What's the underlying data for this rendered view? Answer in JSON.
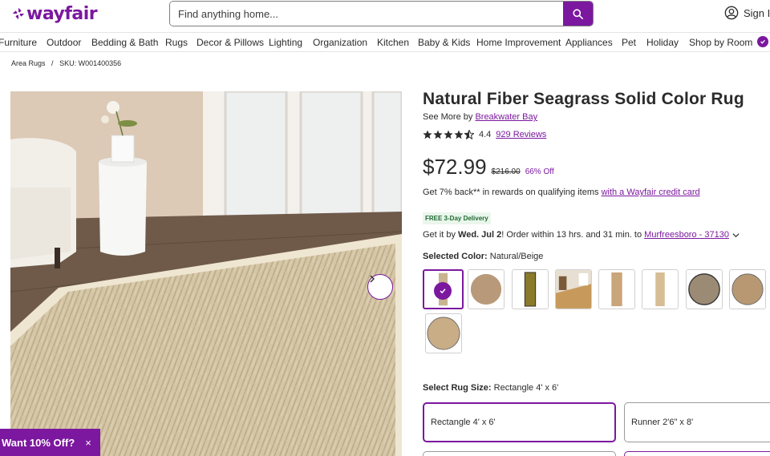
{
  "brand": {
    "name": "wayfair",
    "color": "#7b189f"
  },
  "search": {
    "placeholder": "Find anything home...",
    "icon": "search-icon"
  },
  "account": {
    "label": "Sign In",
    "icon": "user-circle-icon"
  },
  "nav": {
    "items": [
      "Furniture",
      "Outdoor",
      "Bedding & Bath",
      "Rugs",
      "Decor & Pillows",
      "Lighting",
      "Organization",
      "Kitchen",
      "Baby & Kids",
      "Home Improvement",
      "Appliances",
      "Pet",
      "Holiday",
      "Shop by Room"
    ],
    "badge_icon": "verified-check-icon"
  },
  "breadcrumb": {
    "category": "Area Rugs",
    "separator": "/",
    "sku": "SKU: W001400356"
  },
  "product": {
    "title": "Natural Fiber Seagrass Solid Color Rug",
    "see_more_prefix": "See More by",
    "brand": "Breakwater Bay",
    "rating": "4.4",
    "rating_stars": 4.4,
    "reviews": "929 Reviews",
    "price": "$72.99",
    "was_price": "$216.00",
    "discount": "66% Off",
    "rewards_text": "Get 7% back** in rewards on qualifying items",
    "rewards_link": "with a Wayfair credit card",
    "delivery_badge": "FREE 3-Day Delivery",
    "delivery_prefix": "Get it by",
    "delivery_date": "Wed. Jul 2",
    "delivery_suffix": "! Order within 13 hrs. and 31 min. to",
    "delivery_location": "Murfreesboro - 37130",
    "selected_color_label": "Selected Color:",
    "selected_color": "Natural/Beige",
    "size_label": "Select Rug Size:",
    "selected_size": "Rectangle 4' x 6'"
  },
  "swatches": [
    {
      "kind": "runner-selected",
      "color": "#c9b391"
    },
    {
      "kind": "round",
      "color": "#b89a7a"
    },
    {
      "kind": "runner-dark",
      "color": "#8a7a2a"
    },
    {
      "kind": "photo",
      "color": "#c79a5c"
    },
    {
      "kind": "runner",
      "color": "#c9a57a"
    },
    {
      "kind": "runner",
      "color": "#d6bd95"
    },
    {
      "kind": "round",
      "color": "#9c8b74"
    },
    {
      "kind": "round",
      "color": "#b89873"
    },
    {
      "kind": "round",
      "color": "#c9ad86"
    }
  ],
  "sizes": [
    {
      "label": "Rectangle 4' x 6'",
      "selected": true
    },
    {
      "label": "Runner 2'6\" x 8'",
      "selected": false
    }
  ],
  "promo": {
    "label": "Want 10% Off?",
    "close": "×"
  },
  "image_nav": {
    "icon": "chevron-right-icon"
  }
}
